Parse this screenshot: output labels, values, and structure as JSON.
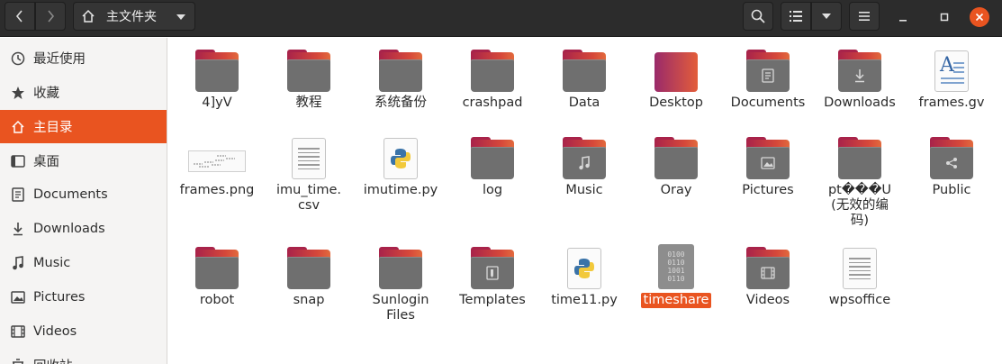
{
  "header": {
    "path_label": "主文件夹",
    "icons": [
      "chevron-left-icon",
      "chevron-right-icon",
      "home-icon",
      "chevron-down-icon",
      "search-icon",
      "list-view-icon",
      "chevron-down-icon",
      "hamburger-menu-icon",
      "minimize-icon",
      "maximize-icon",
      "close-icon"
    ]
  },
  "sidebar": {
    "items": [
      {
        "label": "最近使用",
        "icon": "clock-icon"
      },
      {
        "label": "收藏",
        "icon": "star-icon"
      },
      {
        "label": "主目录",
        "icon": "home-icon",
        "active": true
      },
      {
        "label": "桌面",
        "icon": "desktop-icon"
      },
      {
        "label": "Documents",
        "icon": "document-icon"
      },
      {
        "label": "Downloads",
        "icon": "download-icon"
      },
      {
        "label": "Music",
        "icon": "music-icon"
      },
      {
        "label": "Pictures",
        "icon": "picture-icon"
      },
      {
        "label": "Videos",
        "icon": "video-icon"
      },
      {
        "label": "回收站",
        "icon": "trash-icon"
      }
    ]
  },
  "files": [
    {
      "label": "4]yV",
      "type": "folder"
    },
    {
      "label": "教程",
      "type": "folder"
    },
    {
      "label": "系统备份",
      "type": "folder"
    },
    {
      "label": "crashpad",
      "type": "folder"
    },
    {
      "label": "Data",
      "type": "folder"
    },
    {
      "label": "Desktop",
      "type": "folder-desktop"
    },
    {
      "label": "Documents",
      "type": "folder-documents"
    },
    {
      "label": "Downloads",
      "type": "folder-downloads"
    },
    {
      "label": "frames.gv",
      "type": "gv"
    },
    {
      "label": "frames.png",
      "type": "png"
    },
    {
      "label": "imu_time.csv",
      "type": "doc"
    },
    {
      "label": "imutime.py",
      "type": "py"
    },
    {
      "label": "log",
      "type": "folder"
    },
    {
      "label": "Music",
      "type": "folder-music"
    },
    {
      "label": "Oray",
      "type": "folder"
    },
    {
      "label": "Pictures",
      "type": "folder-pictures"
    },
    {
      "label": "pt���U (无效的编码)",
      "type": "folder"
    },
    {
      "label": "Public",
      "type": "folder-public"
    },
    {
      "label": "robot",
      "type": "folder"
    },
    {
      "label": "snap",
      "type": "folder"
    },
    {
      "label": "Sunlogin Files",
      "type": "folder"
    },
    {
      "label": "Templates",
      "type": "folder-templates"
    },
    {
      "label": "time11.py",
      "type": "py"
    },
    {
      "label": "timeshare",
      "type": "bin",
      "selected": true
    },
    {
      "label": "Videos",
      "type": "folder-videos"
    },
    {
      "label": "wpsoffice",
      "type": "doc"
    }
  ],
  "colors": {
    "accent": "#e95420",
    "header": "#2c2c2c",
    "sidebar": "#f5f4f3"
  }
}
